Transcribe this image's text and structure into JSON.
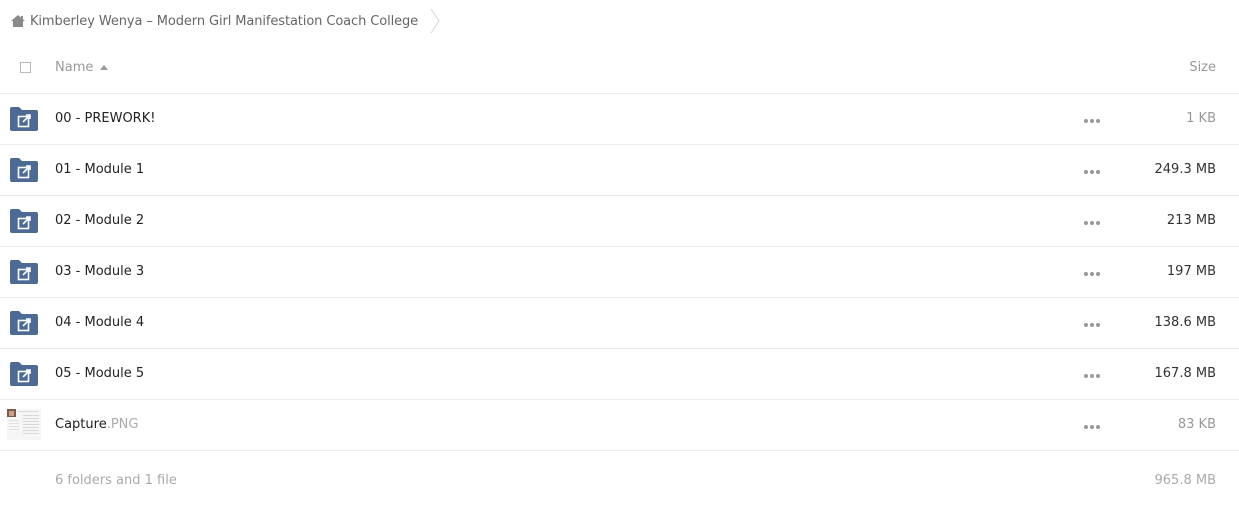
{
  "breadcrumb": {
    "icon": "home-icon",
    "label": "Kimberley Wenya – Modern Girl Manifestation Coach College"
  },
  "header": {
    "name_label": "Name",
    "size_label": "Size"
  },
  "rows": [
    {
      "name": "00 - PREWORK!",
      "ext": "",
      "size": "1 KB",
      "type": "shared-folder"
    },
    {
      "name": "01 - Module 1",
      "ext": "",
      "size": "249.3 MB",
      "type": "shared-folder"
    },
    {
      "name": "02 - Module 2",
      "ext": "",
      "size": "213 MB",
      "type": "shared-folder"
    },
    {
      "name": "03 - Module 3",
      "ext": "",
      "size": "197 MB",
      "type": "shared-folder"
    },
    {
      "name": "04 - Module 4",
      "ext": "",
      "size": "138.6 MB",
      "type": "shared-folder"
    },
    {
      "name": "05 - Module 5",
      "ext": "",
      "size": "167.8 MB",
      "type": "shared-folder"
    },
    {
      "name": "Capture",
      "ext": ".PNG",
      "size": "83 KB",
      "type": "image-file"
    }
  ],
  "footer": {
    "summary": "6 folders and 1 file",
    "total_size": "965.8 MB"
  },
  "colors": {
    "folder": "#4d6a95",
    "divider": "#ebebeb",
    "muted_text": "#999999"
  }
}
